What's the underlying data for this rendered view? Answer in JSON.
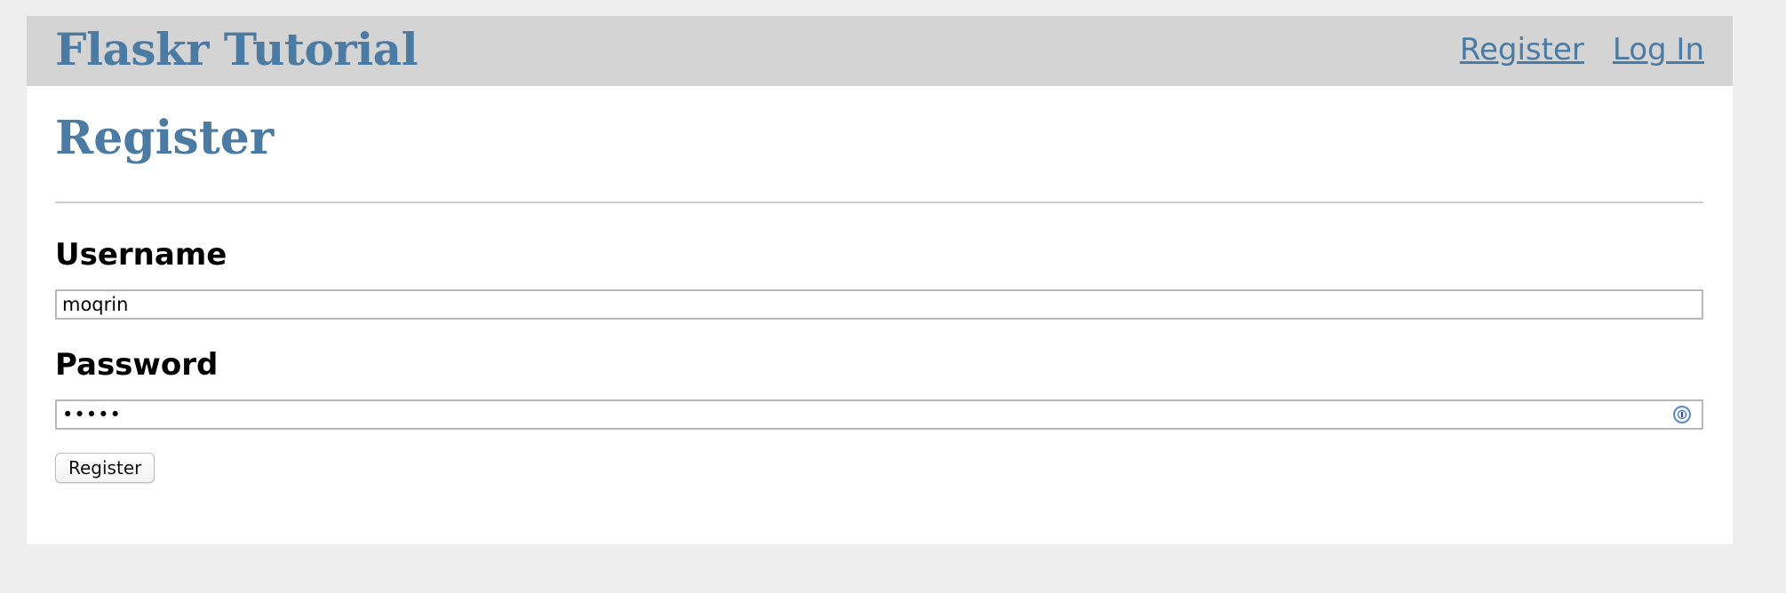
{
  "header": {
    "brand": "Flaskr Tutorial",
    "nav": {
      "register": "Register",
      "login": "Log In"
    }
  },
  "main": {
    "title": "Register",
    "form": {
      "username": {
        "label": "Username",
        "value": "moqrin"
      },
      "password": {
        "label": "Password",
        "value": "•••••"
      },
      "submit_label": "Register"
    }
  },
  "icons": {
    "password_field": "password-manager-icon"
  },
  "colors": {
    "brand": "#4b7aa3",
    "navbar_bg": "#d4d4d4",
    "page_bg": "#eeeeee"
  }
}
